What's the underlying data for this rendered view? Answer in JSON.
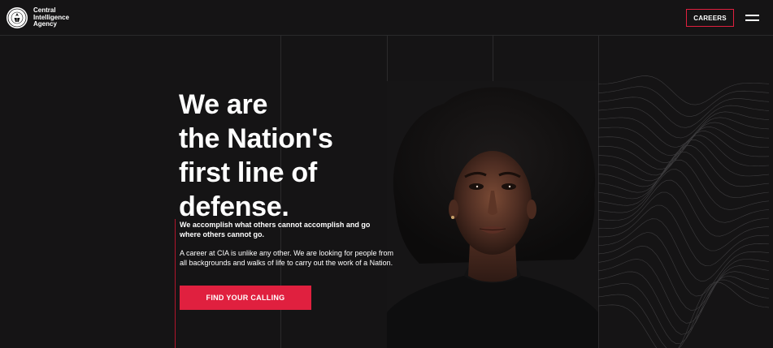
{
  "header": {
    "logo_lines": [
      "Central",
      "Intelligence",
      "Agency"
    ],
    "careers_label": "CAREERS",
    "menu_icon": "hamburger-menu-icon"
  },
  "hero": {
    "headline_lines": [
      "We are",
      "the Nation's",
      "first line of",
      "defense."
    ],
    "subhead": "We accomplish what others cannot accomplish and go where others cannot go.",
    "body": "A career at CIA is unlike any other. We are looking for people from all backgrounds and walks of life to carry out the work of a Nation.",
    "cta_label": "FIND YOUR CALLING"
  },
  "colors": {
    "background": "#151415",
    "accent": "#e0203f",
    "text": "#ffffff"
  }
}
